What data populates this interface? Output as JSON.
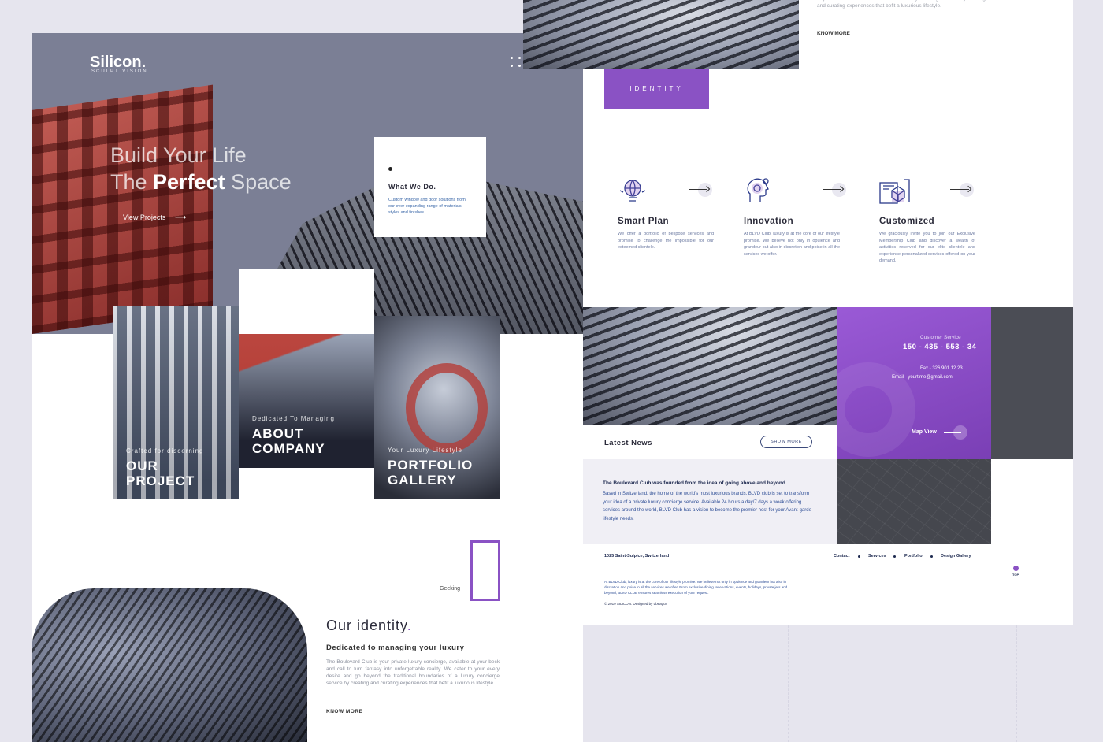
{
  "brand": {
    "name": "Silicon.",
    "tagline": "SCULPT VISION"
  },
  "hero": {
    "line1": "Build Your Life",
    "line2_prefix": "The ",
    "line2_bold": "Perfect",
    "line2_suffix": " Space",
    "cta": "View Projects",
    "cta_arrow": "⟶"
  },
  "what_we_do": {
    "title": "What We Do.",
    "text": "Custom window and door solutions from our ever expanding range of materials, styles and finishes."
  },
  "tiles": [
    {
      "sub": "Crafted for discerning",
      "title_1": "OUR",
      "title_2": "PROJECT"
    },
    {
      "sub": "Dedicated To Managing",
      "title_1": "ABOUT",
      "title_2": "COMPANY"
    },
    {
      "sub": "Your Luxury Lifestyle",
      "title_1": "PORTFOLIO",
      "title_2": "GALLERY"
    }
  ],
  "identity_section": {
    "geeking": "Geeking",
    "heading": "Our identity",
    "heading_dot": ".",
    "subheading": "Dedicated to managing your luxury",
    "body": "The Boulevard Club is your private luxury concierge, available at your beck and call to turn fantasy into unforgettable reality. We cater to your every desire and go beyond the traditional boundaries of a luxury concierge service by creating and curating experiences that befit a luxurious lifestyle.",
    "know_more": "KNOW MORE"
  },
  "right_top": {
    "text": "beyond the traditional boundaries of a luxury concierge service by creating and curating experiences that befit a luxurious lifestyle.",
    "know_more": "KNOW MORE"
  },
  "identity_tab": "IDENTITY",
  "features": [
    {
      "icon": "globe-lightbulb-icon",
      "title": "Smart Plan",
      "text": "We offer a portfolio of bespoke services and promise to challenge the impossible for our esteemed clientele."
    },
    {
      "icon": "head-gears-icon",
      "title": "Innovation",
      "text": "At BLVD Club, luxury is at the core of our lifestyle promise. We believe not only in opulence and grandeur but also in discretion and poise in all the services we offer."
    },
    {
      "icon": "blueprint-box-icon",
      "title": "Customized",
      "text": "We graciously invite you to join our Exclusive Membership Club and discover a wealth of activities reserved for our elite clientele and experience personalized services offered on your demand."
    }
  ],
  "contact": {
    "label": "Customer Service",
    "phone": "150 - 435 - 553 - 34",
    "fax": "Fax - 326 901 12 23",
    "email": "Email - yourtime@gmail.com",
    "map_view": "Map View"
  },
  "news": {
    "heading": "Latest News",
    "show_more": "SHOW MORE",
    "title": "The Boulevard Club was founded from the idea of going above and beyond",
    "body": "Based in Switzerland, the home of the world's most luxurious brands, BLVD club is set to transform your idea of a private luxury concierge service. Available 24 hours a day/7 days a week offering services around the world, BLVD Club has a vision to become the premier host for your Avant-garde lifestyle needs."
  },
  "footer": {
    "address": "1025 Saint-Sulpice, Switzerland",
    "links": [
      "Contact",
      "Services",
      "Portfolio",
      "Design Gallery"
    ],
    "text": "At BLVD Club, luxury is at the core of our lifestyle promise. We believe not only in opulence and grandeur but also in discretion and poise in all the services we offer. From exclusive dining reservations, events, holidays, private jets and beyond, BLVD CLUB ensures seamless execution of your request.",
    "copyright": "© 2019 SILICON. Designed by dbeagur",
    "top": "TOP"
  },
  "colors": {
    "accent": "#8a52c4",
    "hero_bg": "#7b7f95",
    "page_bg": "#e6e5ee"
  }
}
